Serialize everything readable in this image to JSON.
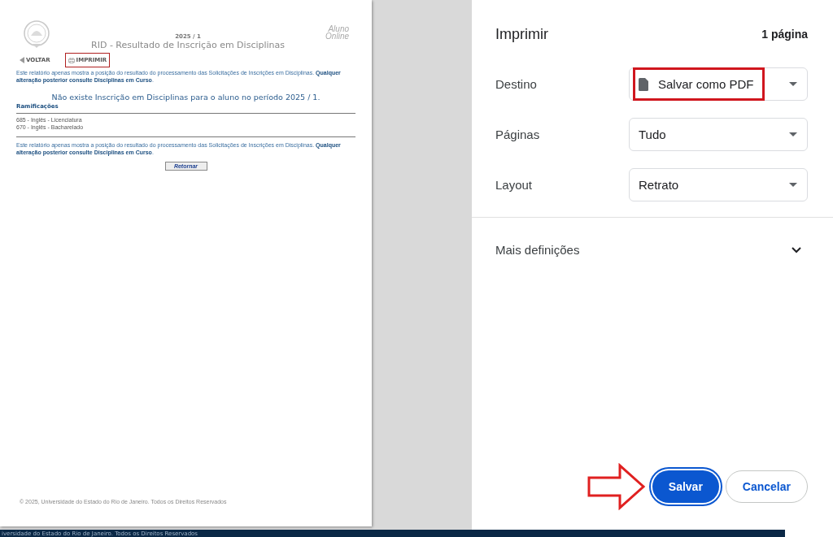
{
  "preview": {
    "period": "2025 / 1",
    "title": "RID - Resultado de Inscrição em Disciplinas",
    "brand": [
      "Aluno",
      "Online"
    ],
    "nav": [
      {
        "label": "VOLTAR",
        "kind": "back",
        "highlighted": false
      },
      {
        "label": "IMPRIMIR",
        "kind": "print",
        "highlighted": true
      }
    ],
    "notice_top": "Este relatório apenas mostra a posição do resultado do processamento das Solicitações de Inscrições em Disciplinas. **Qualquer alteração posterior consulte Disciplinas em Curso**.",
    "message": "Não existe Inscrição em Disciplinas para o aluno no período 2025 / 1.",
    "section_label": "Ramificações",
    "items": [
      "685 - Inglês - Licenciatura",
      "670 - Inglês - Bacharelado"
    ],
    "notice_bottom": "Este relatório apenas mostra a posição do resultado do processamento das Solicitações de Inscrições em Disciplinas. **Qualquer alteração posterior consulte Disciplinas em Curso**.",
    "return_button": "Retornar",
    "footer": "© 2025, Universidade do Estado do Rio de Janeiro. Todos os Direitos Reservados"
  },
  "dialog": {
    "title": "Imprimir",
    "page_count": "1 página",
    "settings": [
      {
        "label": "Destino",
        "value": "Salvar como PDF",
        "kind": "document",
        "highlighted": true
      },
      {
        "label": "Páginas",
        "value": "Tudo",
        "kind": "plain",
        "highlighted": false
      },
      {
        "label": "Layout",
        "value": "Retrato",
        "kind": "plain",
        "highlighted": false
      }
    ],
    "more_settings": {
      "label": "Mais definições",
      "expanded": false
    },
    "buttons": [
      {
        "label": "Salvar",
        "kind": "primary",
        "pointed": true
      },
      {
        "label": "Cancelar",
        "kind": "secondary",
        "pointed": false
      }
    ]
  },
  "background_strip": "iversidade do Estado do Rio de Janeiro. Todos os Direitos Reservados"
}
